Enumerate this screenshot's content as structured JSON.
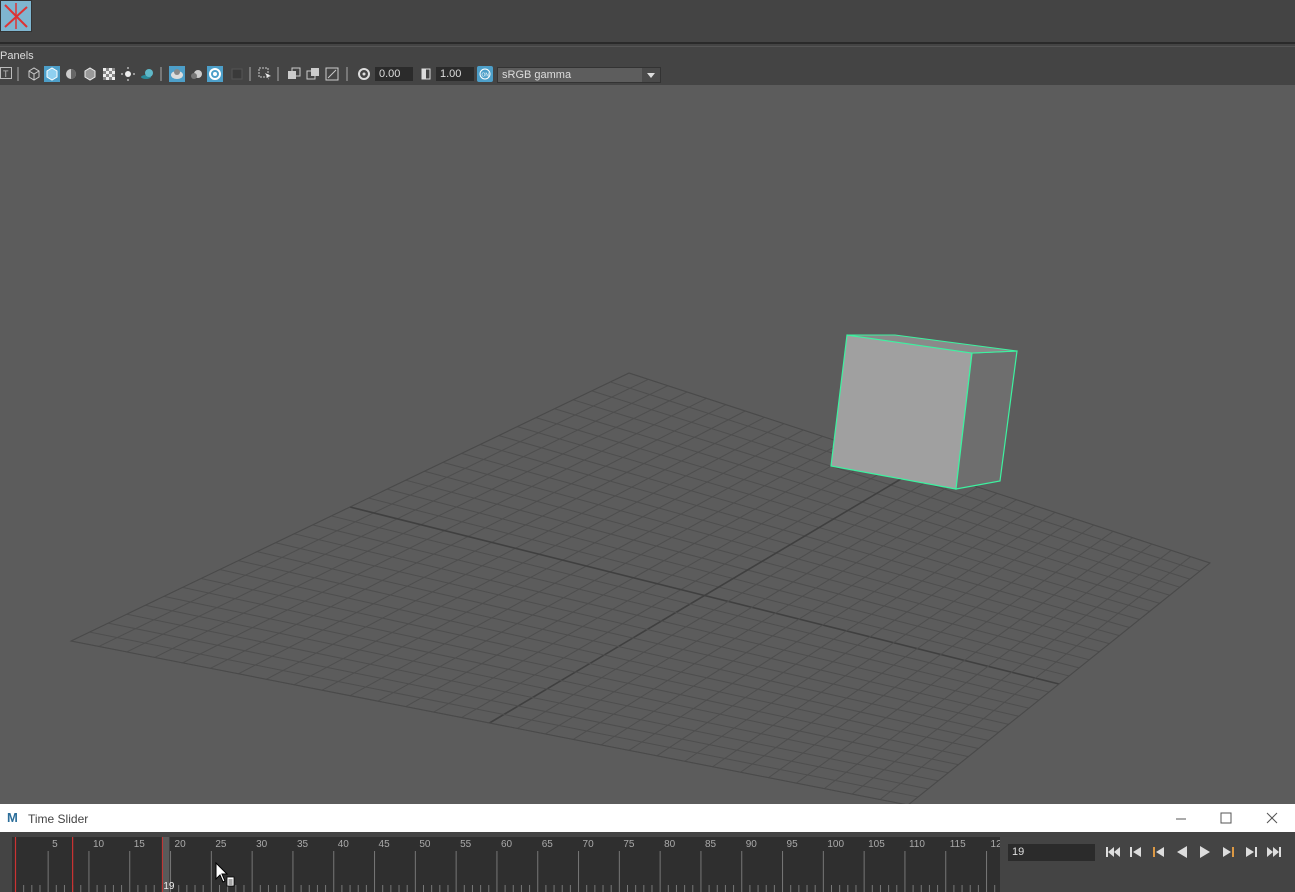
{
  "menubar": {
    "panels_label": "Panels"
  },
  "toolbar": {
    "exposure_value": "0.00",
    "gamma_value": "1.00",
    "color_space": "sRGB gamma"
  },
  "time_slider": {
    "title": "Time Slider",
    "ticks": [
      "5",
      "10",
      "15",
      "20",
      "25",
      "30",
      "35",
      "40",
      "45",
      "50",
      "55",
      "60",
      "65",
      "70",
      "75",
      "80",
      "85",
      "90",
      "95",
      "100",
      "105",
      "110",
      "115",
      "12"
    ],
    "current_frame_marker": "19",
    "current_frame_field": "19"
  },
  "colors": {
    "accent": "#4fd1a1",
    "selection_wire": "#3df2a0",
    "playhead": "#cc3333",
    "viewport_bg": "#5c5c5c"
  },
  "icons": {
    "playback": [
      "go-to-start-icon",
      "step-back-key-icon",
      "step-back-frame-icon",
      "play-backward-icon",
      "play-forward-icon",
      "step-forward-frame-icon",
      "step-forward-key-icon",
      "go-to-end-icon"
    ]
  }
}
